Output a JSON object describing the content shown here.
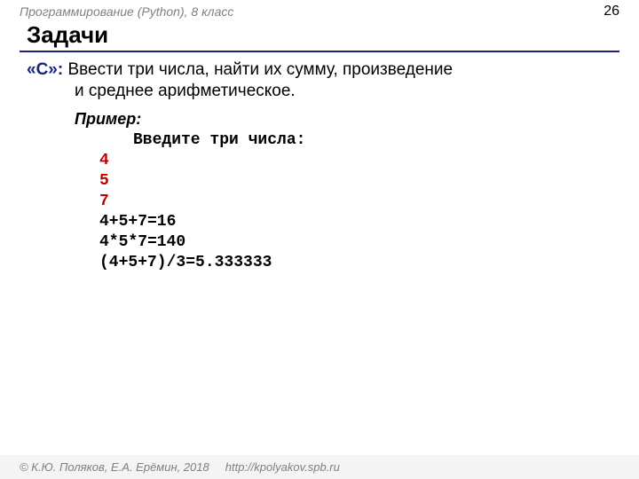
{
  "header": {
    "course": "Программирование (Python), 8 класс",
    "page": "26"
  },
  "title": "Задачи",
  "task": {
    "label": "«C»:",
    "line1": " Ввести три числа, найти их сумму, произведение",
    "line2": "и среднее арифметическое."
  },
  "example": {
    "label": "Пример:",
    "prompt": "Введите три числа:",
    "inputs": [
      "4",
      "5",
      "7"
    ],
    "outputs": [
      "4+5+7=16",
      "4*5*7=140",
      "(4+5+7)/3=5.333333"
    ]
  },
  "footer": {
    "copyright": "© К.Ю. Поляков, Е.А. Ерёмин, 2018",
    "url": "http://kpolyakov.spb.ru"
  }
}
